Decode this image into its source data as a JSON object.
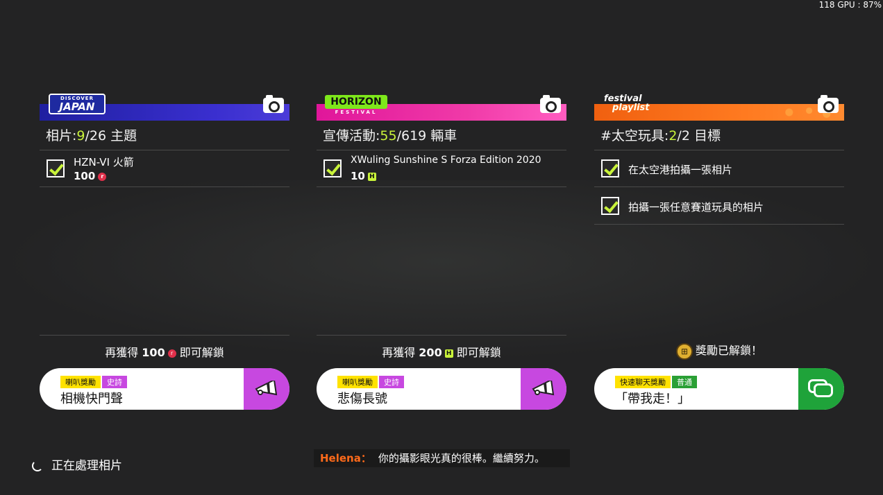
{
  "hud": {
    "fps_text": "118 GPU : 87%"
  },
  "cards": [
    {
      "logo_small": "DISCOVER",
      "logo_main": "JAPAN",
      "title_prefix": "相片:",
      "title_count": "9",
      "title_suffix": "/26 主題",
      "items": [
        {
          "title": "HZN-VI 火箭",
          "points": "100",
          "points_icon": "r"
        }
      ],
      "unlock_prefix": "再獲得",
      "unlock_amount": "100",
      "unlock_icon": "r",
      "unlock_suffix": "即可解鎖",
      "reward": {
        "tag1": "喇叭獎勵",
        "tag2": "史詩",
        "name": "相機快門聲",
        "icon": "horn-icon"
      }
    },
    {
      "logo_main": "HORIZON",
      "logo_small": "FESTIVAL",
      "title_prefix": "宣傳活動:",
      "title_count": "55",
      "title_suffix": "/619 輛車",
      "items": [
        {
          "title": "XWuling Sunshine S Forza Edition 2020",
          "points": "10",
          "points_icon": "H"
        }
      ],
      "unlock_prefix": "再獲得",
      "unlock_amount": "200",
      "unlock_icon": "H",
      "unlock_suffix": "即可解鎖",
      "reward": {
        "tag1": "喇叭獎勵",
        "tag2": "史詩",
        "name": "悲傷長號",
        "icon": "horn-icon"
      }
    },
    {
      "logo_line1": "festival",
      "logo_line2": "playlist",
      "title_prefix": "#太空玩具:",
      "title_count": "2",
      "title_suffix": "/2 目標",
      "items": [
        {
          "text": "在太空港拍攝一張相片"
        },
        {
          "text": "拍攝一張任意賽道玩具的相片"
        }
      ],
      "unlocked_text": "獎勵已解鎖！",
      "reward": {
        "tag1": "快速聊天獎勵",
        "tag2": "普通",
        "name": "「帶我走！」",
        "icon": "chat-icon"
      }
    }
  ],
  "status": {
    "processing": "正在處理相片"
  },
  "dialogue": {
    "speaker": "Helena：",
    "text": "你的攝影眼光真的很棒。繼續努力。"
  },
  "colors": {
    "accent_green": "#c9f33a",
    "epic_purple": "#c748e0",
    "common_green": "#1fa33a"
  }
}
